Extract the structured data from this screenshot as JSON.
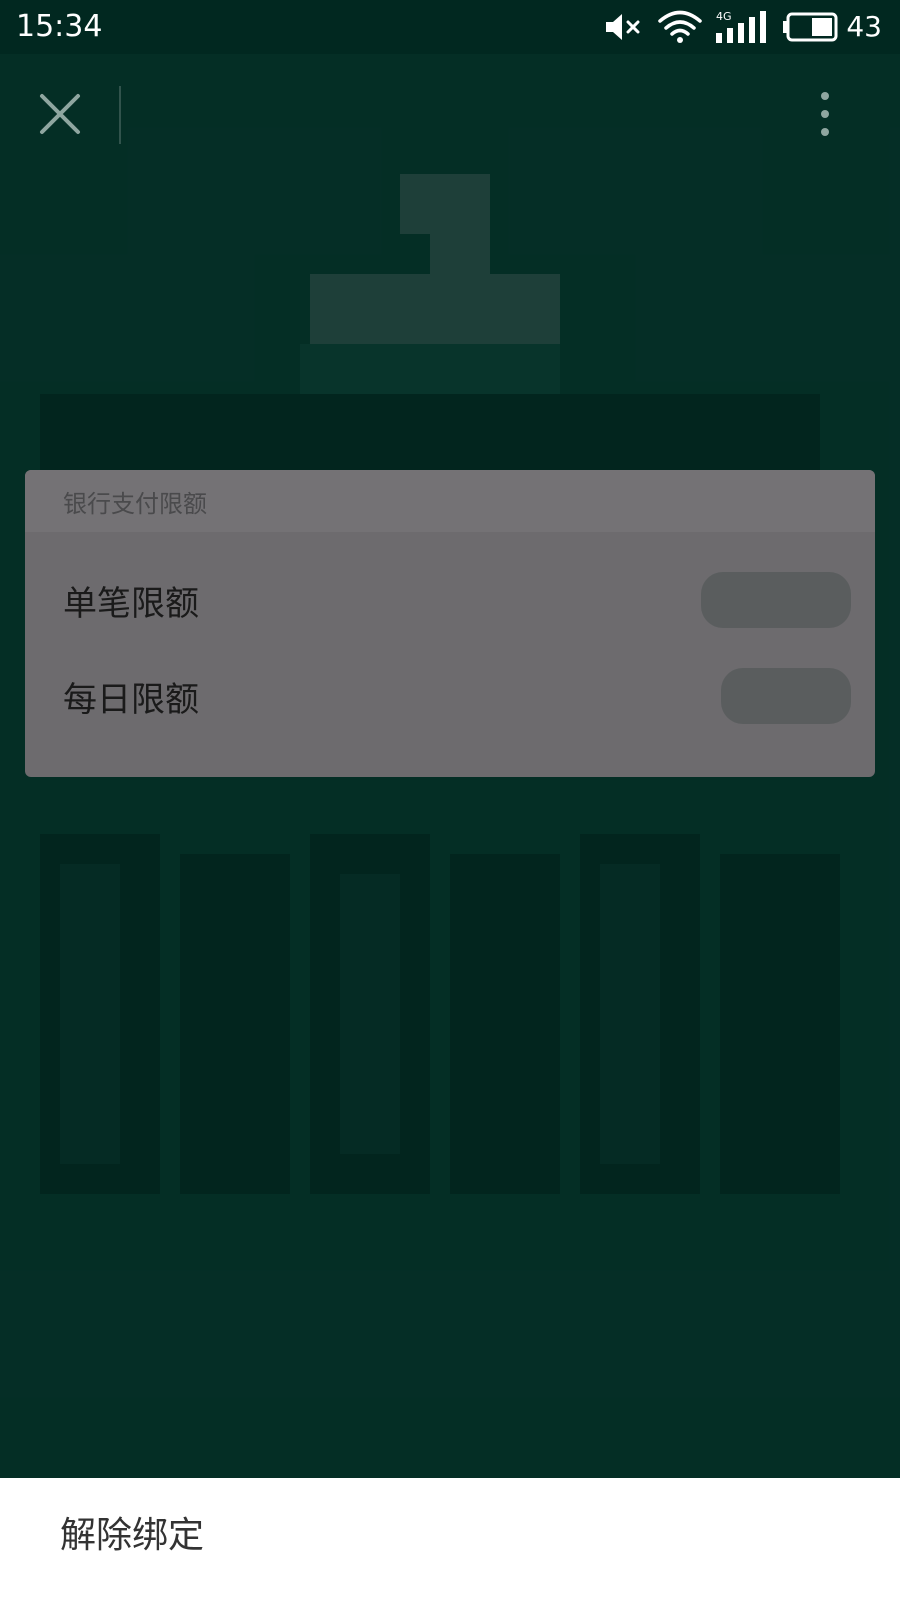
{
  "status_bar": {
    "time": "15:34",
    "network": "4G",
    "battery": "43",
    "icons": [
      "mute-icon",
      "wifi-icon",
      "signal-icon",
      "battery-icon"
    ]
  },
  "toolbar": {
    "close_icon": "close-icon",
    "more_icon": "more-vertical-icon"
  },
  "limit_card": {
    "title": "银行支付限额",
    "rows": [
      {
        "label": "单笔限额"
      },
      {
        "label": "每日限额"
      }
    ]
  },
  "bottom_sheet": {
    "unbind_label": "解除绑定"
  },
  "colors": {
    "page_bg": "#07473a",
    "status_bg": "#012820",
    "card_bg": "#6d6b6e",
    "sheet_bg": "#ffffff"
  }
}
